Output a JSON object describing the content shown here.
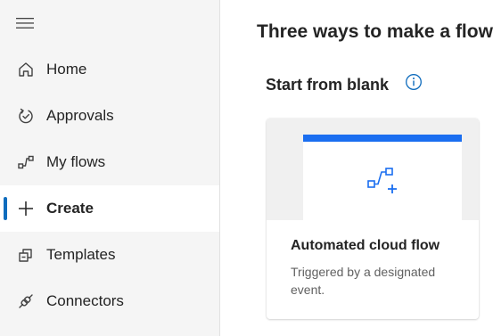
{
  "sidebar": {
    "items": [
      {
        "label": "Home",
        "icon": "home-icon",
        "active": false
      },
      {
        "label": "Approvals",
        "icon": "approvals-icon",
        "active": false
      },
      {
        "label": "My flows",
        "icon": "my-flows-icon",
        "active": false
      },
      {
        "label": "Create",
        "icon": "plus-icon",
        "active": true
      },
      {
        "label": "Templates",
        "icon": "templates-icon",
        "active": false
      },
      {
        "label": "Connectors",
        "icon": "connectors-icon",
        "active": false
      }
    ]
  },
  "main": {
    "title": "Three ways to make a flow",
    "section_title": "Start from blank",
    "cards": [
      {
        "title": "Automated cloud flow",
        "description": "Triggered by a designated event.",
        "icon": "automated-flow-icon"
      }
    ]
  },
  "colors": {
    "accent": "#0f6cbd",
    "preview_bar": "#1a6ef0",
    "sidebar_bg": "#f5f5f5"
  }
}
